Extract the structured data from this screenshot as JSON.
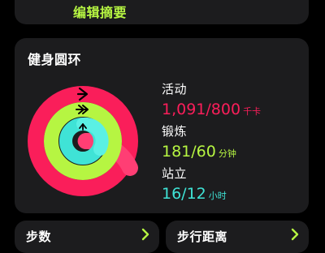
{
  "summary": {
    "edit_link": "编辑摘要"
  },
  "rings_card": {
    "title": "健身圆环",
    "move": {
      "label": "活动",
      "value": "1,091/800",
      "unit": "千卡",
      "progress": 1.364,
      "color": "#fa1e5a"
    },
    "exercise": {
      "label": "锻炼",
      "value": "181/60",
      "unit": "分钟",
      "progress": 3.02,
      "color": "#b6f542"
    },
    "stand": {
      "label": "站立",
      "value": "16/12",
      "unit": "小时",
      "progress": 1.333,
      "color": "#3fe3d6"
    }
  },
  "steps_card": {
    "title": "步数"
  },
  "distance_card": {
    "title": "步行距离"
  },
  "icons": {
    "move_ring_arrow": "single-right-arrow-icon",
    "exercise_ring_arrow": "double-right-arrow-icon",
    "stand_ring_arrow": "up-arrow-icon",
    "card_chevron": "chevron-right-icon"
  }
}
